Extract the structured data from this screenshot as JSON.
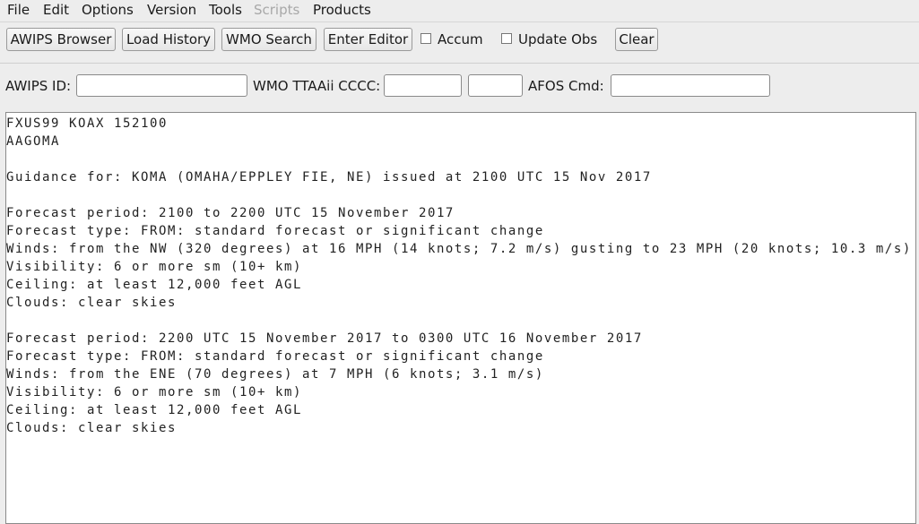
{
  "menubar": {
    "items": [
      {
        "label": "File",
        "enabled": true
      },
      {
        "label": "Edit",
        "enabled": true
      },
      {
        "label": "Options",
        "enabled": true
      },
      {
        "label": "Version",
        "enabled": true
      },
      {
        "label": "Tools",
        "enabled": true
      },
      {
        "label": "Scripts",
        "enabled": false
      },
      {
        "label": "Products",
        "enabled": true
      }
    ]
  },
  "toolbar": {
    "awips_browser": "AWIPS Browser",
    "load_history": "Load History",
    "wmo_search": "WMO Search",
    "enter_editor": "Enter Editor",
    "accum": {
      "label": "Accum",
      "checked": false
    },
    "update_obs": {
      "label": "Update Obs",
      "checked": false
    },
    "clear": "Clear"
  },
  "fields": {
    "awips_id": {
      "label": "AWIPS ID:",
      "value": ""
    },
    "wmo": {
      "label": "WMO TTAAii CCCC:",
      "ttaaii": "",
      "cccc": ""
    },
    "afos": {
      "label": "AFOS Cmd:",
      "value": ""
    }
  },
  "product_text": "FXUS99 KOAX 152100\nAAGOMA\n\nGuidance for: KOMA (OMAHA/EPPLEY FIE, NE) issued at 2100 UTC 15 Nov 2017\n\nForecast period: 2100 to 2200 UTC 15 November 2017\nForecast type: FROM: standard forecast or significant change\nWinds: from the NW (320 degrees) at 16 MPH (14 knots; 7.2 m/s) gusting to 23 MPH (20 knots; 10.3 m/s)\nVisibility: 6 or more sm (10+ km)\nCeiling: at least 12,000 feet AGL\nClouds: clear skies\n\nForecast period: 2200 UTC 15 November 2017 to 0300 UTC 16 November 2017\nForecast type: FROM: standard forecast or significant change\nWinds: from the ENE (70 degrees) at 7 MPH (6 knots; 3.1 m/s)\nVisibility: 6 or more sm (10+ km)\nCeiling: at least 12,000 feet AGL\nClouds: clear skies"
}
